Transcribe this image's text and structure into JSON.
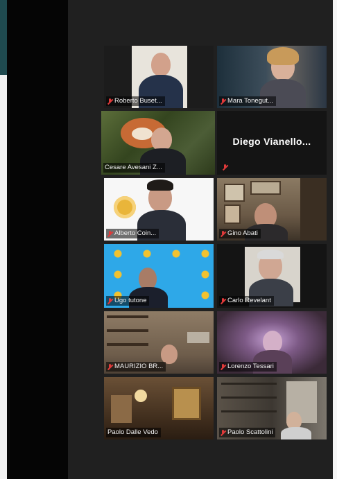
{
  "participants": [
    {
      "name": "Roberto Buset...",
      "muted": true
    },
    {
      "name": "Mara Tonegut...",
      "muted": true
    },
    {
      "name": "Cesare Avesani Z...",
      "muted": false,
      "active_speaker": true
    },
    {
      "name": "Diego Vianello...",
      "muted": true,
      "video_off": true
    },
    {
      "name": "Alberto Coin...",
      "muted": true
    },
    {
      "name": "Gino Abati",
      "muted": true
    },
    {
      "name": "Ugo tutone",
      "muted": true
    },
    {
      "name": "Carlo Revelant",
      "muted": true
    },
    {
      "name": "MAURIZIO BR...",
      "muted": true
    },
    {
      "name": "Lorenzo Tessari",
      "muted": true
    },
    {
      "name": "Paolo Dalle Vedo",
      "muted": false
    },
    {
      "name": "Paolo Scattolini",
      "muted": true
    }
  ],
  "colors": {
    "active_border": "#d8e27a",
    "muted_icon": "#e03a3a",
    "gallery_bg": "#202020"
  }
}
